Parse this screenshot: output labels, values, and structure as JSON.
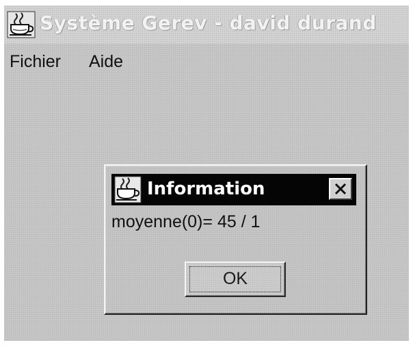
{
  "window": {
    "title": "Système Gerev - david durand",
    "icon": "coffee-cup-icon"
  },
  "menubar": {
    "items": [
      {
        "label": "Fichier"
      },
      {
        "label": "Aide"
      }
    ]
  },
  "dialog": {
    "title": "Information",
    "icon": "coffee-cup-icon",
    "close_icon": "close-icon",
    "message": "moyenne(0)= 45 / 1",
    "ok_label": "OK"
  },
  "colors": {
    "window_bg": "#c6c6c6",
    "dialog_titlebar": "#050505",
    "dialog_title_text": "#ffffff",
    "window_title_text": "#f2f2f2"
  }
}
